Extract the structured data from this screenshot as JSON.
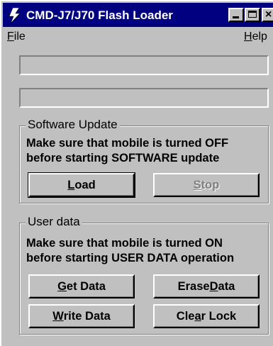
{
  "window": {
    "title": "CMD-J7/J70 Flash Loader"
  },
  "menu": {
    "file": {
      "accel": "F",
      "rest": "ile"
    },
    "help": {
      "accel": "H",
      "rest": "elp"
    }
  },
  "progress": [
    {
      "value": 0
    },
    {
      "value": 0
    }
  ],
  "software_update": {
    "title": "Software Update",
    "line1": "Make sure that mobile is turned OFF",
    "line2": "before starting SOFTWARE update",
    "load": {
      "pre": "",
      "accel": "L",
      "post": "oad"
    },
    "stop": {
      "pre": "",
      "accel": "S",
      "post": "top",
      "enabled": false
    }
  },
  "user_data": {
    "title": "User data",
    "line1": "Make sure that mobile is turned ON",
    "line2": "before starting USER DATA operation",
    "get": {
      "pre": "",
      "accel": "G",
      "post": "et Data"
    },
    "erase": {
      "pre": "Erase ",
      "accel": "D",
      "post": "ata"
    },
    "write": {
      "pre": "",
      "accel": "W",
      "post": "rite Data"
    },
    "clear": {
      "pre": "Cle",
      "accel": "a",
      "post": "r Lock"
    }
  },
  "colors": {
    "titlebar": "#000080",
    "face": "#c0c0c0"
  }
}
